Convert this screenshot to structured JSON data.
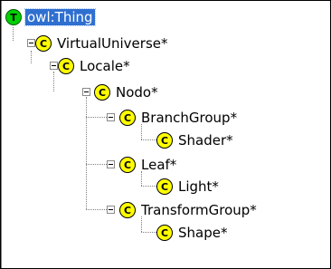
{
  "tree": {
    "root": {
      "badge": "T",
      "label": "owl:Thing",
      "selected": true
    },
    "nodes": [
      {
        "badge": "C",
        "label": "VirtualUniverse*",
        "expanded": true
      },
      {
        "badge": "C",
        "label": "Locale*",
        "expanded": true
      },
      {
        "badge": "C",
        "label": "Nodo*",
        "expanded": true
      },
      {
        "badge": "C",
        "label": "BranchGroup*",
        "expanded": true
      },
      {
        "badge": "C",
        "label": "Shader*",
        "expanded": false
      },
      {
        "badge": "C",
        "label": "Leaf*",
        "expanded": true
      },
      {
        "badge": "C",
        "label": "Light*",
        "expanded": false
      },
      {
        "badge": "C",
        "label": "TransformGroup*",
        "expanded": true
      },
      {
        "badge": "C",
        "label": "Shape*",
        "expanded": false
      }
    ]
  },
  "colors": {
    "class_badge": "#ffff00",
    "thing_badge": "#00d000",
    "selection": "#2f6fd0"
  }
}
